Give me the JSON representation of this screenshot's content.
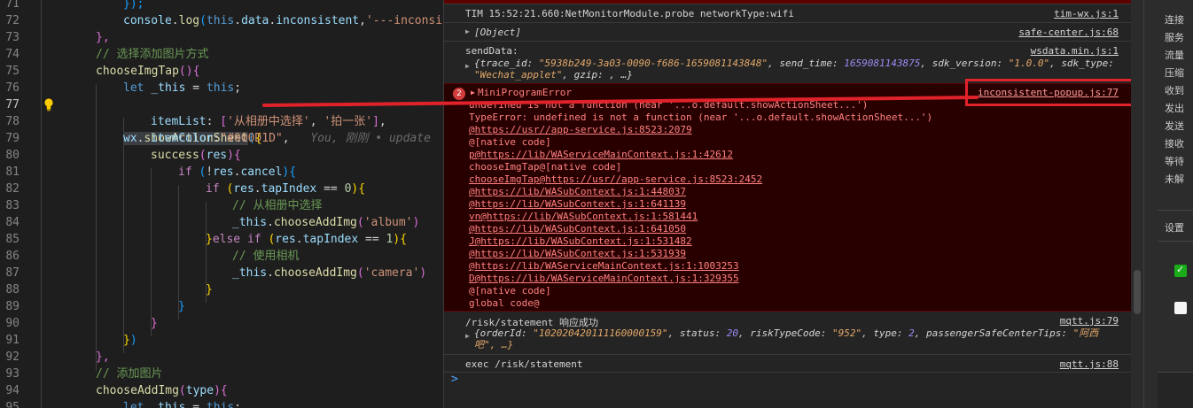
{
  "editor": {
    "lines": [
      {
        "n": "71"
      },
      {
        "n": "72"
      },
      {
        "n": "73"
      },
      {
        "n": "74"
      },
      {
        "n": "75"
      },
      {
        "n": "76"
      },
      {
        "n": "77"
      },
      {
        "n": "78"
      },
      {
        "n": "79"
      },
      {
        "n": "80"
      },
      {
        "n": "81"
      },
      {
        "n": "82"
      },
      {
        "n": "83"
      },
      {
        "n": "84"
      },
      {
        "n": "85"
      },
      {
        "n": "86"
      },
      {
        "n": "87"
      },
      {
        "n": "88"
      },
      {
        "n": "89"
      },
      {
        "n": "90"
      },
      {
        "n": "91"
      },
      {
        "n": "92"
      },
      {
        "n": "93"
      },
      {
        "n": "94"
      },
      {
        "n": "95"
      }
    ],
    "t": {
      "l71_close": "});",
      "l72_console": "console",
      "l72_log": "log",
      "l72_this": "this",
      "l72_data": "data",
      "l72_prop": "inconsistent",
      "l72_str": "'---inconsis",
      "l73": "},",
      "l74_comment": "// 选择添加图片方式",
      "l75_fn": "chooseImgTap",
      "l76_let": "let",
      "l76_var": "_this",
      "l76_this": "this",
      "l77_wx": "wx",
      "l77_call": "showActionSheet",
      "l77_ghost": "You, 刚刚 • update",
      "l78_key": "itemList",
      "l78_s1": "'从相册中选择'",
      "l78_s2": "'拍一张'",
      "l79_key": "itemColor",
      "l79_val": "\"#000D1D\"",
      "l80_fn": "success",
      "l80_arg": "res",
      "l81_if": "if",
      "l81_res": "res",
      "l81_prop": "cancel",
      "l82_if": "if",
      "l82_res": "res",
      "l82_prop": "tapIndex",
      "l82_num": "0",
      "l83_comment": "// 从相册中选择",
      "l84_this": "_this",
      "l84_fn": "chooseAddImg",
      "l84_arg": "'album'",
      "l85_else": "else",
      "l85_if": "if",
      "l85_res": "res",
      "l85_prop": "tapIndex",
      "l85_num": "1",
      "l86_comment": "// 使用相机",
      "l87_this": "_this",
      "l87_fn": "chooseAddImg",
      "l87_arg": "'camera'",
      "l93_comment": "// 添加图片",
      "l94_fn": "chooseAddImg",
      "l94_arg": "type",
      "l95_let": "let",
      "l95_var": "_this",
      "l95_this": "this"
    }
  },
  "console": {
    "top_partial": "...NetMonitorModule...",
    "rows": {
      "tim_msg": "TIM 15:52:21.660:NetMonitorModule.probe networkType:wifi",
      "tim_src": "tim-wx.js:1",
      "object_label": "[Object]",
      "object_src": "safe-center.js:68",
      "senddata_msg": "sendData:",
      "senddata_src": "wsdata.min.js:1",
      "sd_trace_key": "trace_id:",
      "sd_trace_val": "\"5938b249-3a03-0090-f686-1659081143848\"",
      "sd_time_key": "send_time:",
      "sd_time_val": "1659081143875",
      "sd_sdk_key": "sdk_version:",
      "sd_sdk_val": "\"1.0.0\"",
      "sd_type_key": "sdk_type:",
      "sd_type_val": "\"Wechat_applet\"",
      "sd_gzip": "gzip: , …}",
      "risk_msg": "/risk/statement 响应成功",
      "risk_src": "mqtt.js:79",
      "risk_order_key": "orderId:",
      "risk_order_val": "\"102020420111160000159\"",
      "risk_status_key": "status:",
      "risk_status_val": "20",
      "risk_code_key": "riskTypeCode:",
      "risk_code_val": "\"952\"",
      "risk_type_key": "type:",
      "risk_type_val": "2",
      "risk_tips_key": "passengerSafeCenterTips:",
      "risk_tips_val": "\"阿西",
      "risk_line2": "吧\", …}",
      "exec_msg": "exec /risk/statement",
      "exec_src": "mqtt.js:88",
      "prompt": ">"
    },
    "error": {
      "count": "2",
      "title": "MiniProgramError",
      "src": "inconsistent-popup.js:77",
      "lines": [
        "undefined is not a function (near '...o.default.showActionSheet...')",
        "TypeError: undefined is not a function (near '...o.default.showActionSheet...')",
        "@https://usr//app-service.js:8523:2079",
        "@[native code]",
        "p@https://lib/WAServiceMainContext.js:1:42612",
        "chooseImgTap@[native code]",
        "chooseImgTap@https://usr//app-service.js:8523:2452",
        "@https://lib/WASubContext.js:1:448037",
        "@https://lib/WASubContext.js:1:641139",
        "vn@https://lib/WASubContext.js:1:581441",
        "@https://lib/WASubContext.js:1:641050",
        "J@https://lib/WASubContext.js:1:531482",
        "@https://lib/WASubContext.js:1:531939",
        "@https://lib/WAServiceMainContext.js:1:1003253",
        "D@https://lib/WAServiceMainContext.js:1:329355",
        "@[native code]",
        "global code@"
      ]
    }
  },
  "right_panel": {
    "items": [
      "连接",
      "服务",
      "流量",
      "压缩",
      "收到",
      "发出",
      "发送",
      "接收",
      "等待",
      "未解"
    ],
    "settings": "设置",
    "checkbox_checked": true,
    "checkbox_unchecked": false
  },
  "colors": {
    "highlight_box": "#e0222a",
    "error_background": "#290000",
    "checkbox_on": "#1aad19"
  }
}
